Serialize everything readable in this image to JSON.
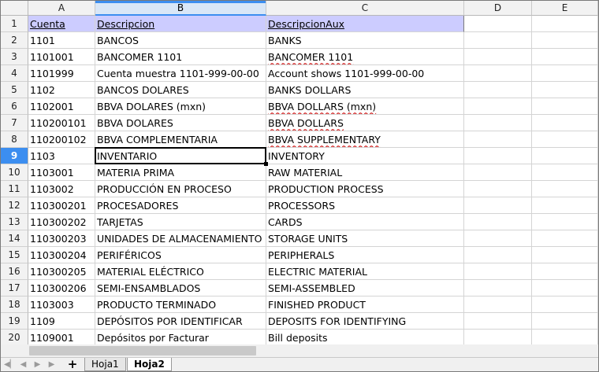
{
  "columns": [
    {
      "letter": "A",
      "width": 85
    },
    {
      "letter": "B",
      "width": 217
    },
    {
      "letter": "C",
      "width": 251
    },
    {
      "letter": "D",
      "width": 86
    },
    {
      "letter": "E",
      "width": 87
    }
  ],
  "selected_column": "B",
  "selected_row": 9,
  "header": {
    "cuenta": "Cuenta",
    "descripcion": "Descripcion",
    "descripcion_aux": "DescripcionAux"
  },
  "rows": [
    {
      "num": "2",
      "a": "1101",
      "b": "BANCOS",
      "c": "BANKS"
    },
    {
      "num": "3",
      "a": "1101001",
      "b": "BANCOMER 1101",
      "c": "BANCOMER 1101"
    },
    {
      "num": "4",
      "a": "1101999",
      "b": "Cuenta muestra 1101-999-00-00",
      "c": "Account shows 1101-999-00-00"
    },
    {
      "num": "5",
      "a": "1102",
      "b": "BANCOS DOLARES",
      "c": "BANKS DOLLARS"
    },
    {
      "num": "6",
      "a": "1102001",
      "b": "BBVA DOLARES (mxn)",
      "c": "BBVA DOLLARS (mxn)"
    },
    {
      "num": "7",
      "a": "110200101",
      "b": "BBVA DOLARES",
      "c": "BBVA DOLLARS"
    },
    {
      "num": "8",
      "a": "110200102",
      "b": "BBVA COMPLEMENTARIA",
      "c": "BBVA SUPPLEMENTARY"
    },
    {
      "num": "9",
      "a": "1103",
      "b": "INVENTARIO",
      "c": "INVENTORY"
    },
    {
      "num": "10",
      "a": "1103001",
      "b": "MATERIA PRIMA",
      "c": "RAW MATERIAL"
    },
    {
      "num": "11",
      "a": "1103002",
      "b": "PRODUCCIÓN EN PROCESO",
      "c": "PRODUCTION PROCESS"
    },
    {
      "num": "12",
      "a": "110300201",
      "b": "PROCESADORES",
      "c": "PROCESSORS"
    },
    {
      "num": "13",
      "a": "110300202",
      "b": "TARJETAS",
      "c": "CARDS"
    },
    {
      "num": "14",
      "a": "110300203",
      "b": "UNIDADES DE ALMACENAMIENTO",
      "c": "STORAGE UNITS"
    },
    {
      "num": "15",
      "a": "110300204",
      "b": "PERIFÉRICOS",
      "c": "PERIPHERALS"
    },
    {
      "num": "16",
      "a": "110300205",
      "b": "MATERIAL ELÉCTRICO",
      "c": "ELECTRIC MATERIAL"
    },
    {
      "num": "17",
      "a": "110300206",
      "b": "SEMI-ENSAMBLADOS",
      "c": "SEMI-ASSEMBLED"
    },
    {
      "num": "18",
      "a": "1103003",
      "b": "PRODUCTO TERMINADO",
      "c": "FINISHED PRODUCT"
    },
    {
      "num": "19",
      "a": "1109",
      "b": "DEPÓSITOS POR IDENTIFICAR",
      "c": "DEPOSITS FOR IDENTIFYING"
    },
    {
      "num": "20",
      "a": "1109001",
      "b": "Depósitos por Facturar",
      "c": "Bill deposits"
    }
  ],
  "spellcheck_flagged_rows": [
    "3",
    "6",
    "7",
    "8"
  ],
  "sheet_tabs": [
    {
      "label": "Hoja1",
      "active": false
    },
    {
      "label": "Hoja2",
      "active": true
    }
  ],
  "add_sheet_label": "+",
  "colors": {
    "header_fill": "#ccccff",
    "selection_accent": "#3c8ef0",
    "spell_underline": "#d02020"
  },
  "icons": [
    "first-sheet-icon",
    "prev-sheet-icon",
    "next-sheet-icon",
    "last-sheet-icon",
    "add-sheet-icon"
  ]
}
